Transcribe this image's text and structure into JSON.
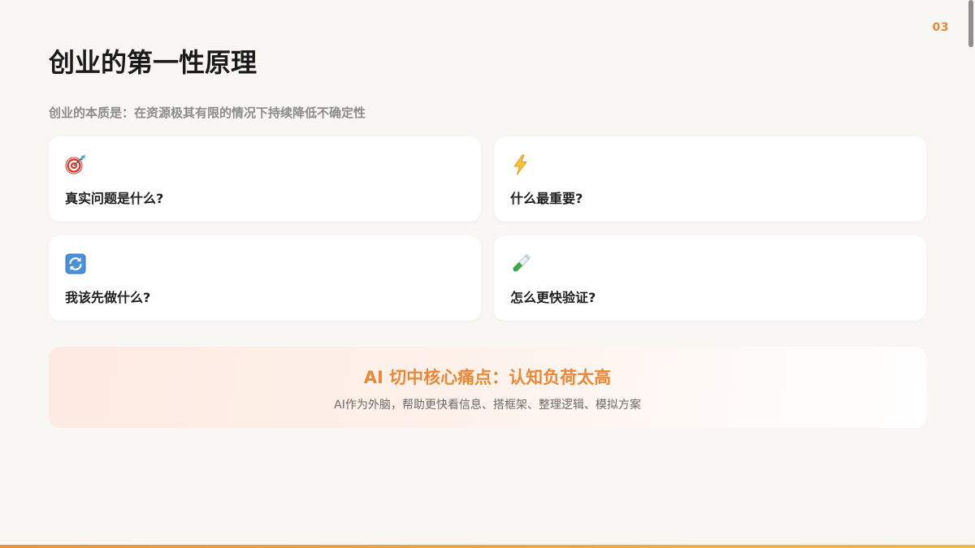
{
  "page_number": "03",
  "title": "创业的第一性原理",
  "subtitle": "创业的本质是：在资源极其有限的情况下持续降低不确定性",
  "cards": [
    {
      "icon": "target-icon",
      "label": "真实问题是什么?"
    },
    {
      "icon": "lightning-icon",
      "label": "什么最重要?"
    },
    {
      "icon": "refresh-icon",
      "label": "我该先做什么?"
    },
    {
      "icon": "test-tube-icon",
      "label": "怎么更快验证?"
    }
  ],
  "highlight": {
    "title": "AI 切中核心痛点：认知负荷太高",
    "text": "AI作为外脑，帮助更快看信息、搭框架、整理逻辑、模拟方案"
  },
  "colors": {
    "accent": "#e8883a",
    "background": "#f9f7f4",
    "card": "#ffffff"
  }
}
